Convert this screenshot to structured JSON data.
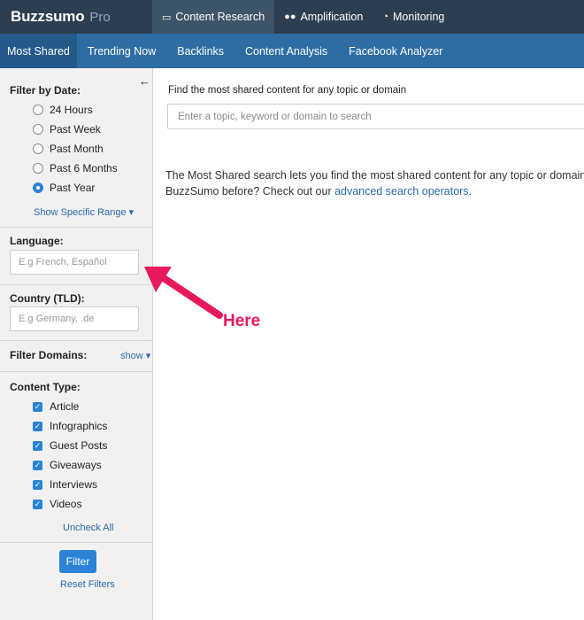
{
  "brand": {
    "name": "Buzzsumo",
    "tier": "Pro"
  },
  "topnav": [
    {
      "label": "Content Research",
      "icon": "laptop-icon",
      "glyph": "💻"
    },
    {
      "label": "Amplification",
      "icon": "users-icon",
      "glyph": "👥"
    },
    {
      "label": "Monitoring",
      "icon": "dashboard-icon",
      "glyph": "◔"
    }
  ],
  "subnav": [
    "Most Shared",
    "Trending Now",
    "Backlinks",
    "Content Analysis",
    "Facebook Analyzer"
  ],
  "sidebar": {
    "date_title": "Filter by Date:",
    "date_options": [
      "24 Hours",
      "Past Week",
      "Past Month",
      "Past 6 Months",
      "Past Year"
    ],
    "date_selected": "Past Year",
    "show_range": "Show Specific Range ▾",
    "language_title": "Language:",
    "language_placeholder": "E.g French, Español",
    "country_title": "Country (TLD):",
    "country_placeholder": "E.g Germany, .de",
    "domains_title": "Filter Domains:",
    "domains_show": "show ▾",
    "content_title": "Content Type:",
    "content_types": [
      "Article",
      "Infographics",
      "Guest Posts",
      "Giveaways",
      "Interviews",
      "Videos"
    ],
    "uncheck_all": "Uncheck All",
    "filter_button": "Filter",
    "reset_filters": "Reset Filters"
  },
  "main": {
    "search_label": "Find the most shared content for any topic or domain",
    "search_placeholder": "Enter a topic, keyword or domain to search",
    "desc_line1": "The Most Shared search lets you find the most shared content for any topic or domain.",
    "desc_line2_prefix": "BuzzSumo before? Check out our ",
    "desc_link": "advanced search operators",
    "desc_line2_suffix": "."
  },
  "annotation": {
    "text": "Here",
    "color": "#e8195a"
  },
  "colors": {
    "topbar": "#2c3e50",
    "subnav": "#2e6da4",
    "accent": "#2a83d6",
    "link": "#2a6aa8"
  }
}
